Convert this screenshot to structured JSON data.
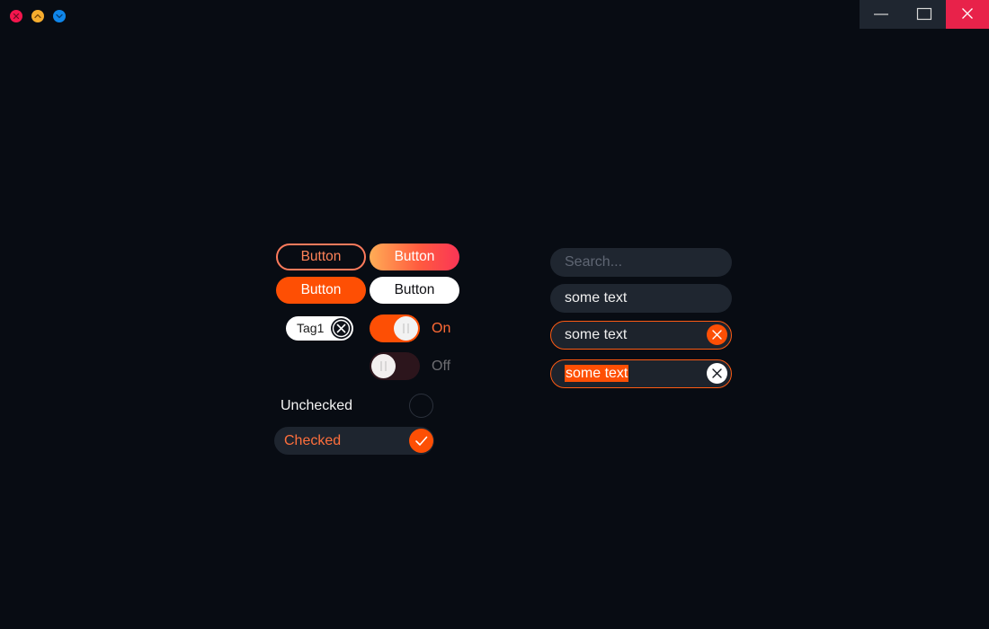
{
  "window": {
    "traffic_lights": {
      "close_color": "#f3164d",
      "minimize_color": "#f6ad2e",
      "zoom_color": "#0f86ea"
    },
    "caption_buttons": [
      "minimize",
      "maximize",
      "close"
    ]
  },
  "buttons": {
    "outline_label": "Button",
    "gradient_label": "Button",
    "solid_label": "Button",
    "white_label": "Button"
  },
  "tag": {
    "label": "Tag1"
  },
  "toggles": {
    "on_label": "On",
    "off_label": "Off",
    "on_state": true,
    "off_state": false
  },
  "checkboxes": {
    "unchecked_label": "Unchecked",
    "checked_label": "Checked"
  },
  "fields": {
    "search_placeholder": "Search...",
    "plain_value": "some text",
    "focused_value": "some text",
    "selected_value": "some text"
  },
  "colors": {
    "accent": "#fd4f05",
    "background": "#080c13",
    "field_background": "#1f2630"
  }
}
